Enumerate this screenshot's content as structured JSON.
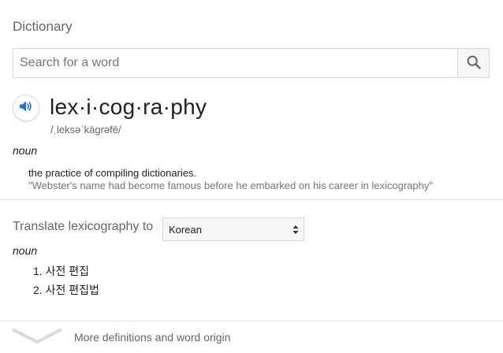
{
  "dictionary": {
    "title": "Dictionary",
    "search": {
      "value": "",
      "placeholder": "Search for a word",
      "icon": "magnifier-icon"
    },
    "entry": {
      "speaker_icon": "speaker-icon",
      "headword": "lex·i·cog·ra·phy",
      "pronunciation": "/ˌleksəˈkägrəfē/",
      "part_of_speech": "noun",
      "definition": "the practice of compiling dictionaries.",
      "example": "\"Webster's name had become famous before he embarked on his career in lexicography\""
    },
    "translate": {
      "label": "Translate lexicography to",
      "selected_language": "Korean",
      "part_of_speech": "noun",
      "translations": [
        "1. 사전 편집",
        "2. 사전 편집법"
      ]
    },
    "more": {
      "label": "More definitions and word origin",
      "icon": "chevron-down-icon"
    }
  }
}
